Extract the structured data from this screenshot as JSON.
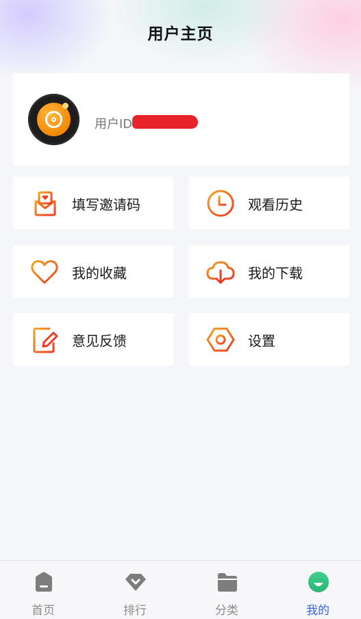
{
  "header": {
    "title": "用户主页"
  },
  "profile": {
    "user_id_label": "用户ID"
  },
  "menu": [
    {
      "label": "填写邀请码",
      "icon": "invite-envelope-icon"
    },
    {
      "label": "观看历史",
      "icon": "clock-icon"
    },
    {
      "label": "我的收藏",
      "icon": "heart-icon"
    },
    {
      "label": "我的下载",
      "icon": "cloud-download-icon"
    },
    {
      "label": "意见反馈",
      "icon": "feedback-edit-icon"
    },
    {
      "label": "设置",
      "icon": "settings-hexagon-icon"
    }
  ],
  "tabbar": [
    {
      "label": "首页",
      "icon": "home-icon",
      "active": false
    },
    {
      "label": "排行",
      "icon": "ranking-diamond-icon",
      "active": false
    },
    {
      "label": "分类",
      "icon": "category-folder-icon",
      "active": false
    },
    {
      "label": "我的",
      "icon": "profile-smile-icon",
      "active": true
    }
  ],
  "colors": {
    "accent_orange": "#f5821f",
    "accent_red": "#ee3b24",
    "tab_active": "#3a62d8",
    "tab_inactive": "#8c8c8c"
  }
}
